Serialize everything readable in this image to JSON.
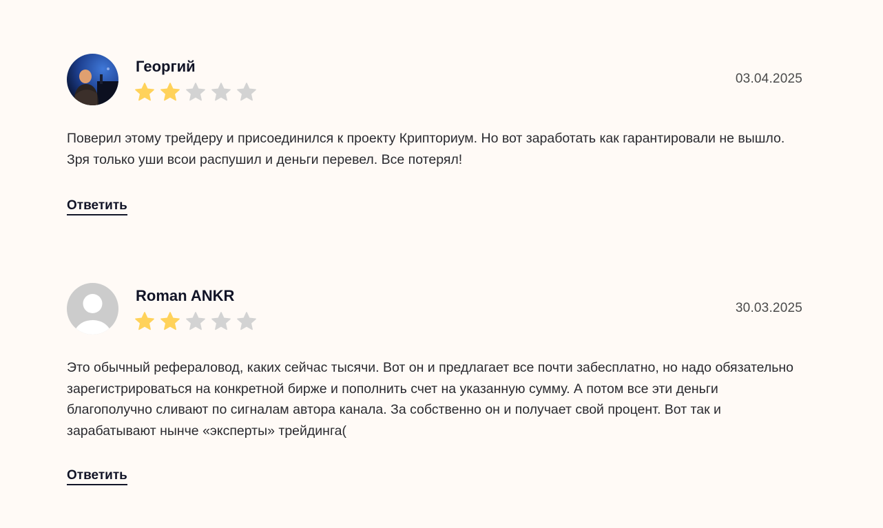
{
  "colors": {
    "background": "#fffaf6",
    "star_filled": "#ffd25a",
    "star_empty": "#d3d3d3",
    "link": "#111427"
  },
  "reviews": [
    {
      "author": "Георгий",
      "avatar": "user-photo",
      "rating": 2,
      "max_rating": 5,
      "date": "03.04.2025",
      "text": "Поверил этому трейдеру и присоединился к проекту Крипториум. Но вот заработать как гарантировали не вышло. Зря только уши всои распушил и деньги перевел. Все потерял!",
      "reply_label": "Ответить"
    },
    {
      "author": "Roman ANKR",
      "avatar": "default-user-icon",
      "rating": 2,
      "max_rating": 5,
      "date": "30.03.2025",
      "text": "Это обычный рефераловод, каких сейчас тысячи. Вот он и предлагает все почти забесплатно, но надо обязательно зарегистрироваться на конкретной бирже и пополнить счет на указанную сумму. А потом все эти деньги благополучно сливают по сигналам автора канала. За собственно он и получает свой процент. Вот так и зарабатывают нынче «эксперты» трейдинга(",
      "reply_label": "Ответить"
    }
  ]
}
